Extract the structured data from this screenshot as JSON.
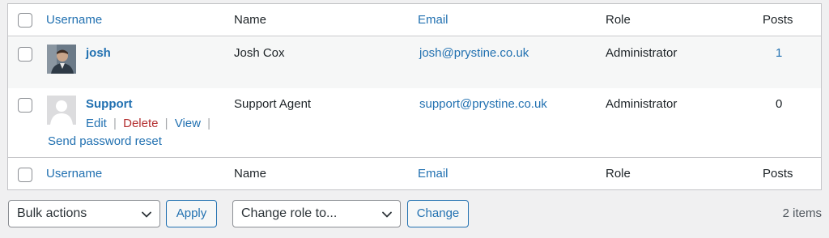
{
  "columns": {
    "username": "Username",
    "name": "Name",
    "email": "Email",
    "role": "Role",
    "posts": "Posts"
  },
  "users": [
    {
      "username": "josh",
      "name": "Josh Cox",
      "email": "josh@prystine.co.uk",
      "role": "Administrator",
      "posts": "1",
      "avatar_icon": "user-photo-icon"
    },
    {
      "username": "Support",
      "name": "Support Agent",
      "email": "support@prystine.co.uk",
      "role": "Administrator",
      "posts": "0",
      "avatar_icon": "default-avatar-icon",
      "row_actions": {
        "edit": "Edit",
        "delete": "Delete",
        "view": "View",
        "separator": "|",
        "send_reset": "Send password reset"
      }
    }
  ],
  "bulk": {
    "select_value": "Bulk actions",
    "apply_label": "Apply"
  },
  "role_change": {
    "select_value": "Change role to...",
    "change_label": "Change"
  },
  "item_count": "2 items",
  "colors": {
    "link": "#2271b1",
    "delete": "#b32d2e",
    "row_alt": "#f6f7f7",
    "page_bg": "#f0f0f1"
  }
}
